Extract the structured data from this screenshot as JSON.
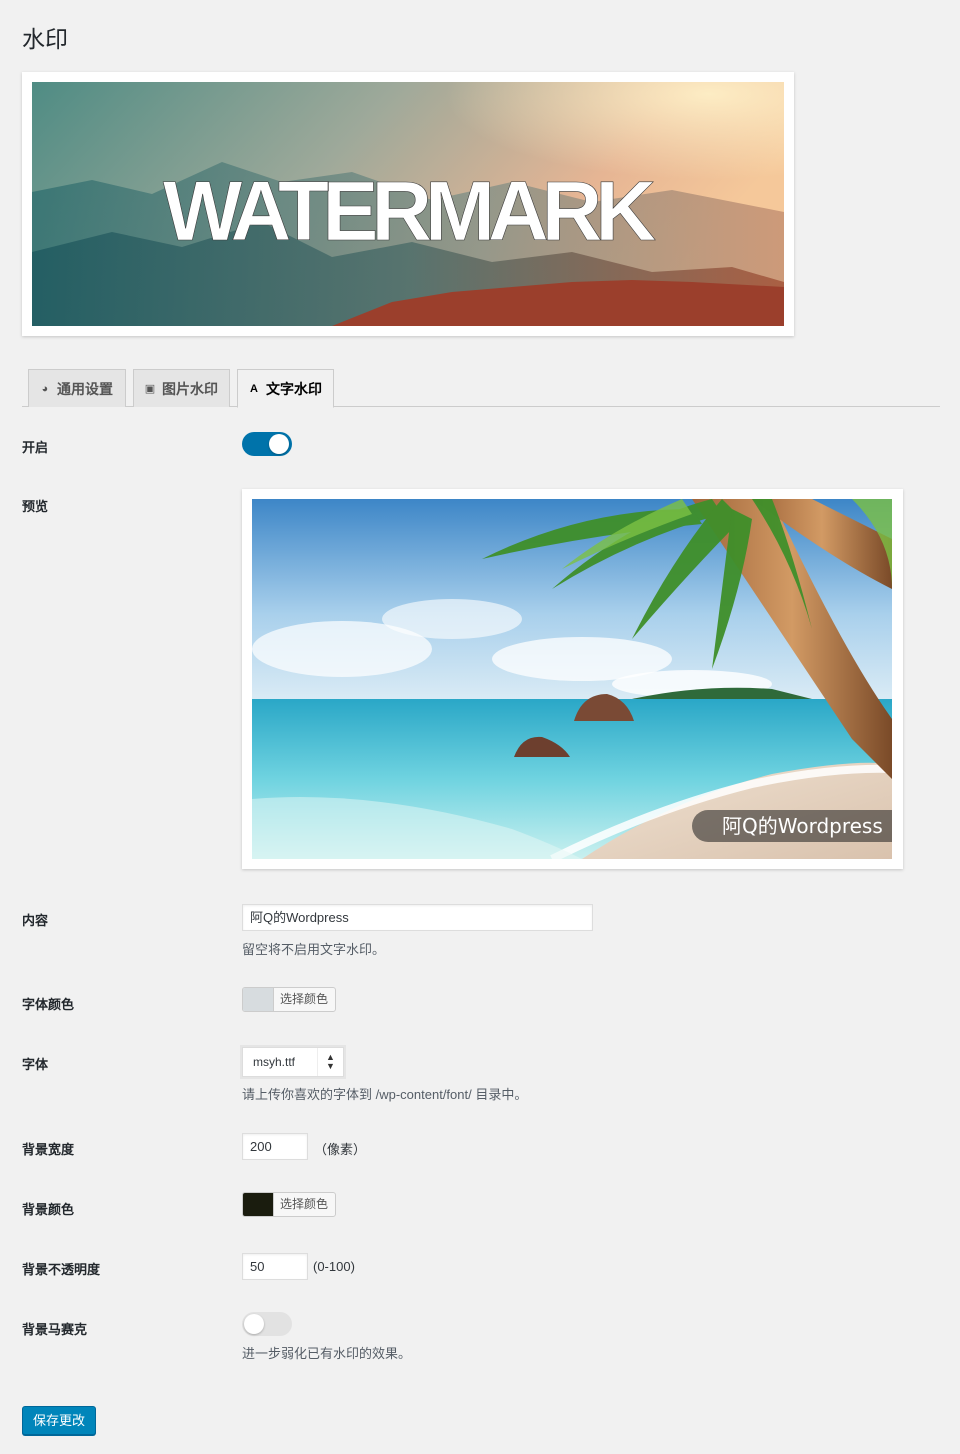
{
  "page": {
    "title": "水印"
  },
  "banner": {
    "text": "WATERMARK"
  },
  "tabs": [
    {
      "label": "通用设置",
      "icon": "dashboard-icon",
      "active": false
    },
    {
      "label": "图片水印",
      "icon": "image-icon",
      "active": false
    },
    {
      "label": "文字水印",
      "icon": "text-icon",
      "active": true
    }
  ],
  "form": {
    "enable": {
      "label": "开启",
      "value": true
    },
    "preview": {
      "label": "预览",
      "watermark_text": "阿Q的Wordpress"
    },
    "content": {
      "label": "内容",
      "value": "阿Q的Wordpress",
      "description": "留空将不启用文字水印。"
    },
    "font_color": {
      "label": "字体颜色",
      "button_label": "选择颜色",
      "color": "#d7dcdf"
    },
    "font": {
      "label": "字体",
      "value": "msyh.ttf",
      "description": "请上传你喜欢的字体到 /wp-content/font/ 目录中。"
    },
    "bg_width": {
      "label": "背景宽度",
      "value": "200",
      "unit": "（像素）"
    },
    "bg_color": {
      "label": "背景颜色",
      "button_label": "选择颜色",
      "color": "#1a1c0e"
    },
    "bg_opacity": {
      "label": "背景不透明度",
      "value": "50",
      "unit": "(0-100)"
    },
    "bg_mosaic": {
      "label": "背景马赛克",
      "value": false,
      "description": "进一步弱化已有水印的效果。"
    }
  },
  "save_button": {
    "label": "保存更改"
  },
  "colors": {
    "accent": "#0073aa",
    "button": "#0085ba"
  }
}
